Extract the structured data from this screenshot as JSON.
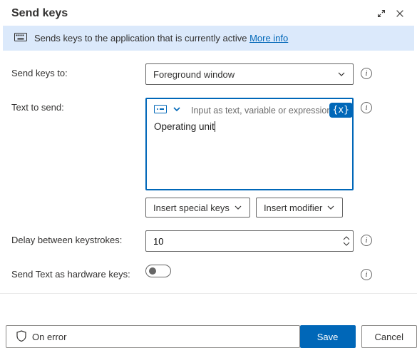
{
  "title": "Send keys",
  "banner": {
    "text": "Sends keys to the application that is currently active",
    "link": "More info"
  },
  "fields": {
    "sendKeysTo": {
      "label": "Send keys to:",
      "value": "Foreground window"
    },
    "textToSend": {
      "label": "Text to send:",
      "placeholder": "Input as text, variable or expression",
      "value": "Operating unit",
      "varBtn": "{x}"
    },
    "insertSpecialKeys": "Insert special keys",
    "insertModifier": "Insert modifier",
    "delay": {
      "label": "Delay between keystrokes:",
      "value": "10"
    },
    "hardwareKeys": {
      "label": "Send Text as hardware keys:"
    }
  },
  "footer": {
    "onError": "On error",
    "save": "Save",
    "cancel": "Cancel"
  }
}
